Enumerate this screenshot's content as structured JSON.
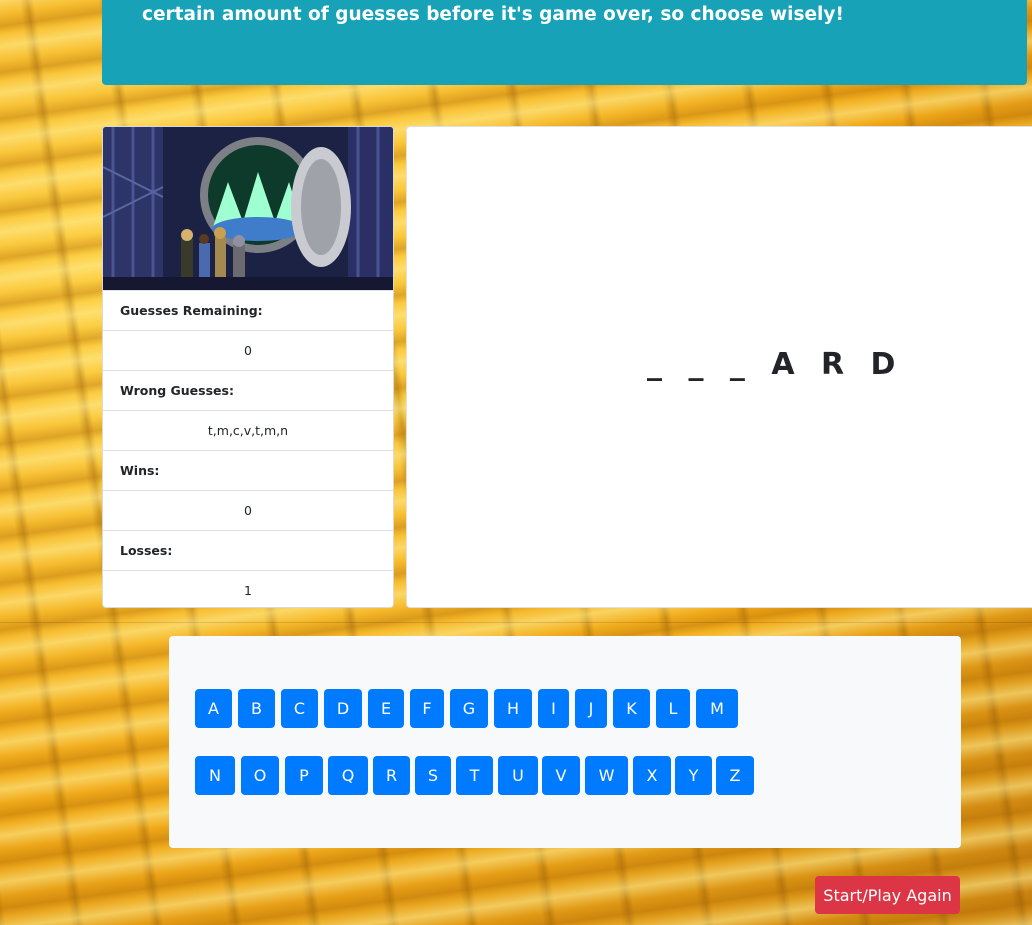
{
  "banner": {
    "text": "certain amount of guesses before it's game over, so choose wisely!"
  },
  "stats": {
    "guesses_remaining_label": "Guesses Remaining:",
    "guesses_remaining_value": "0",
    "wrong_guesses_label": "Wrong Guesses:",
    "wrong_guesses_value": "t,m,c,v,t,m,n",
    "wins_label": "Wins:",
    "wins_value": "0",
    "losses_label": "Losses:",
    "losses_value": "1"
  },
  "word": {
    "display": "_ _ _ A R D"
  },
  "keyboard": {
    "row1": [
      "A",
      "B",
      "C",
      "D",
      "E",
      "F",
      "G",
      "H",
      "I",
      "J",
      "K",
      "L",
      "M"
    ],
    "row2": [
      "N",
      "O",
      "P",
      "Q",
      "R",
      "S",
      "T",
      "U",
      "V",
      "W",
      "X",
      "Y",
      "Z"
    ]
  },
  "actions": {
    "play_again_label": "Start/Play Again"
  },
  "colors": {
    "banner": "#17a2b8",
    "key": "#007bff",
    "play_again": "#dc3545"
  }
}
